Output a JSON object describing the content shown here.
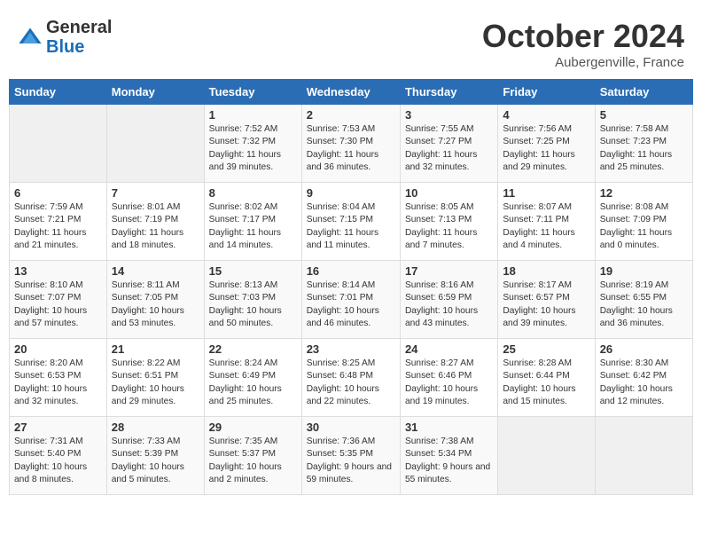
{
  "header": {
    "logo_general": "General",
    "logo_blue": "Blue",
    "month_title": "October 2024",
    "location": "Aubergenville, France"
  },
  "weekdays": [
    "Sunday",
    "Monday",
    "Tuesday",
    "Wednesday",
    "Thursday",
    "Friday",
    "Saturday"
  ],
  "weeks": [
    [
      {
        "day": "",
        "sunrise": "",
        "sunset": "",
        "daylight": "",
        "empty": true
      },
      {
        "day": "",
        "sunrise": "",
        "sunset": "",
        "daylight": "",
        "empty": true
      },
      {
        "day": "1",
        "sunrise": "Sunrise: 7:52 AM",
        "sunset": "Sunset: 7:32 PM",
        "daylight": "Daylight: 11 hours and 39 minutes.",
        "empty": false
      },
      {
        "day": "2",
        "sunrise": "Sunrise: 7:53 AM",
        "sunset": "Sunset: 7:30 PM",
        "daylight": "Daylight: 11 hours and 36 minutes.",
        "empty": false
      },
      {
        "day": "3",
        "sunrise": "Sunrise: 7:55 AM",
        "sunset": "Sunset: 7:27 PM",
        "daylight": "Daylight: 11 hours and 32 minutes.",
        "empty": false
      },
      {
        "day": "4",
        "sunrise": "Sunrise: 7:56 AM",
        "sunset": "Sunset: 7:25 PM",
        "daylight": "Daylight: 11 hours and 29 minutes.",
        "empty": false
      },
      {
        "day": "5",
        "sunrise": "Sunrise: 7:58 AM",
        "sunset": "Sunset: 7:23 PM",
        "daylight": "Daylight: 11 hours and 25 minutes.",
        "empty": false
      }
    ],
    [
      {
        "day": "6",
        "sunrise": "Sunrise: 7:59 AM",
        "sunset": "Sunset: 7:21 PM",
        "daylight": "Daylight: 11 hours and 21 minutes.",
        "empty": false
      },
      {
        "day": "7",
        "sunrise": "Sunrise: 8:01 AM",
        "sunset": "Sunset: 7:19 PM",
        "daylight": "Daylight: 11 hours and 18 minutes.",
        "empty": false
      },
      {
        "day": "8",
        "sunrise": "Sunrise: 8:02 AM",
        "sunset": "Sunset: 7:17 PM",
        "daylight": "Daylight: 11 hours and 14 minutes.",
        "empty": false
      },
      {
        "day": "9",
        "sunrise": "Sunrise: 8:04 AM",
        "sunset": "Sunset: 7:15 PM",
        "daylight": "Daylight: 11 hours and 11 minutes.",
        "empty": false
      },
      {
        "day": "10",
        "sunrise": "Sunrise: 8:05 AM",
        "sunset": "Sunset: 7:13 PM",
        "daylight": "Daylight: 11 hours and 7 minutes.",
        "empty": false
      },
      {
        "day": "11",
        "sunrise": "Sunrise: 8:07 AM",
        "sunset": "Sunset: 7:11 PM",
        "daylight": "Daylight: 11 hours and 4 minutes.",
        "empty": false
      },
      {
        "day": "12",
        "sunrise": "Sunrise: 8:08 AM",
        "sunset": "Sunset: 7:09 PM",
        "daylight": "Daylight: 11 hours and 0 minutes.",
        "empty": false
      }
    ],
    [
      {
        "day": "13",
        "sunrise": "Sunrise: 8:10 AM",
        "sunset": "Sunset: 7:07 PM",
        "daylight": "Daylight: 10 hours and 57 minutes.",
        "empty": false
      },
      {
        "day": "14",
        "sunrise": "Sunrise: 8:11 AM",
        "sunset": "Sunset: 7:05 PM",
        "daylight": "Daylight: 10 hours and 53 minutes.",
        "empty": false
      },
      {
        "day": "15",
        "sunrise": "Sunrise: 8:13 AM",
        "sunset": "Sunset: 7:03 PM",
        "daylight": "Daylight: 10 hours and 50 minutes.",
        "empty": false
      },
      {
        "day": "16",
        "sunrise": "Sunrise: 8:14 AM",
        "sunset": "Sunset: 7:01 PM",
        "daylight": "Daylight: 10 hours and 46 minutes.",
        "empty": false
      },
      {
        "day": "17",
        "sunrise": "Sunrise: 8:16 AM",
        "sunset": "Sunset: 6:59 PM",
        "daylight": "Daylight: 10 hours and 43 minutes.",
        "empty": false
      },
      {
        "day": "18",
        "sunrise": "Sunrise: 8:17 AM",
        "sunset": "Sunset: 6:57 PM",
        "daylight": "Daylight: 10 hours and 39 minutes.",
        "empty": false
      },
      {
        "day": "19",
        "sunrise": "Sunrise: 8:19 AM",
        "sunset": "Sunset: 6:55 PM",
        "daylight": "Daylight: 10 hours and 36 minutes.",
        "empty": false
      }
    ],
    [
      {
        "day": "20",
        "sunrise": "Sunrise: 8:20 AM",
        "sunset": "Sunset: 6:53 PM",
        "daylight": "Daylight: 10 hours and 32 minutes.",
        "empty": false
      },
      {
        "day": "21",
        "sunrise": "Sunrise: 8:22 AM",
        "sunset": "Sunset: 6:51 PM",
        "daylight": "Daylight: 10 hours and 29 minutes.",
        "empty": false
      },
      {
        "day": "22",
        "sunrise": "Sunrise: 8:24 AM",
        "sunset": "Sunset: 6:49 PM",
        "daylight": "Daylight: 10 hours and 25 minutes.",
        "empty": false
      },
      {
        "day": "23",
        "sunrise": "Sunrise: 8:25 AM",
        "sunset": "Sunset: 6:48 PM",
        "daylight": "Daylight: 10 hours and 22 minutes.",
        "empty": false
      },
      {
        "day": "24",
        "sunrise": "Sunrise: 8:27 AM",
        "sunset": "Sunset: 6:46 PM",
        "daylight": "Daylight: 10 hours and 19 minutes.",
        "empty": false
      },
      {
        "day": "25",
        "sunrise": "Sunrise: 8:28 AM",
        "sunset": "Sunset: 6:44 PM",
        "daylight": "Daylight: 10 hours and 15 minutes.",
        "empty": false
      },
      {
        "day": "26",
        "sunrise": "Sunrise: 8:30 AM",
        "sunset": "Sunset: 6:42 PM",
        "daylight": "Daylight: 10 hours and 12 minutes.",
        "empty": false
      }
    ],
    [
      {
        "day": "27",
        "sunrise": "Sunrise: 7:31 AM",
        "sunset": "Sunset: 5:40 PM",
        "daylight": "Daylight: 10 hours and 8 minutes.",
        "empty": false
      },
      {
        "day": "28",
        "sunrise": "Sunrise: 7:33 AM",
        "sunset": "Sunset: 5:39 PM",
        "daylight": "Daylight: 10 hours and 5 minutes.",
        "empty": false
      },
      {
        "day": "29",
        "sunrise": "Sunrise: 7:35 AM",
        "sunset": "Sunset: 5:37 PM",
        "daylight": "Daylight: 10 hours and 2 minutes.",
        "empty": false
      },
      {
        "day": "30",
        "sunrise": "Sunrise: 7:36 AM",
        "sunset": "Sunset: 5:35 PM",
        "daylight": "Daylight: 9 hours and 59 minutes.",
        "empty": false
      },
      {
        "day": "31",
        "sunrise": "Sunrise: 7:38 AM",
        "sunset": "Sunset: 5:34 PM",
        "daylight": "Daylight: 9 hours and 55 minutes.",
        "empty": false
      },
      {
        "day": "",
        "sunrise": "",
        "sunset": "",
        "daylight": "",
        "empty": true
      },
      {
        "day": "",
        "sunrise": "",
        "sunset": "",
        "daylight": "",
        "empty": true
      }
    ]
  ]
}
